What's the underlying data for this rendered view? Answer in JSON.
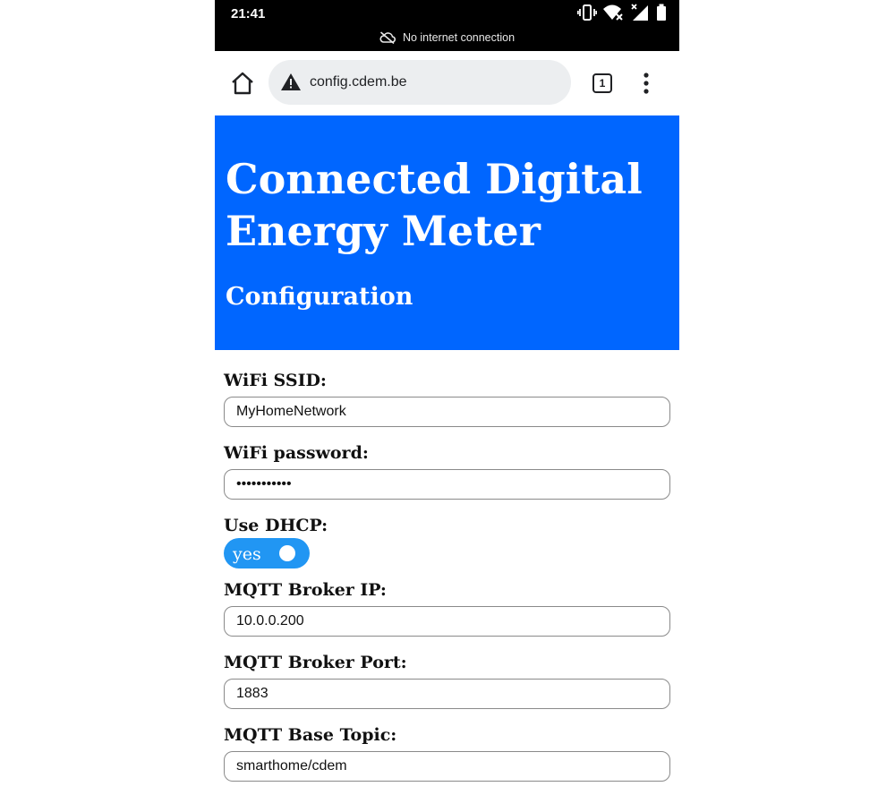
{
  "status_bar": {
    "time": "21:41",
    "offline_text": "No internet connection",
    "icons": [
      "vibrate-icon",
      "wifi-off-icon",
      "signal-icon",
      "battery-icon",
      "cloud-off-icon"
    ]
  },
  "browser": {
    "url": "config.cdem.be",
    "tab_count": "1",
    "icons": [
      "home-icon",
      "warning-icon",
      "tabs-icon",
      "more-vert-icon"
    ]
  },
  "header": {
    "title": "Connected Digital Energy Meter",
    "subtitle": "Configuration",
    "background": "#0066ff"
  },
  "form": {
    "wifi_ssid_label": "WiFi SSID:",
    "wifi_ssid_value": "MyHomeNetwork",
    "wifi_password_label": "WiFi password:",
    "wifi_password_value": "•••••••••••",
    "dhcp_label": "Use DHCP:",
    "dhcp_toggle_label": "yes",
    "dhcp_enabled": true,
    "toggle_color": "#2196f3",
    "mqtt_ip_label": "MQTT Broker IP:",
    "mqtt_ip_value": "10.0.0.200",
    "mqtt_port_label": "MQTT Broker Port:",
    "mqtt_port_value": "1883",
    "mqtt_topic_label": "MQTT Base Topic:",
    "mqtt_topic_value": "smarthome/cdem"
  }
}
